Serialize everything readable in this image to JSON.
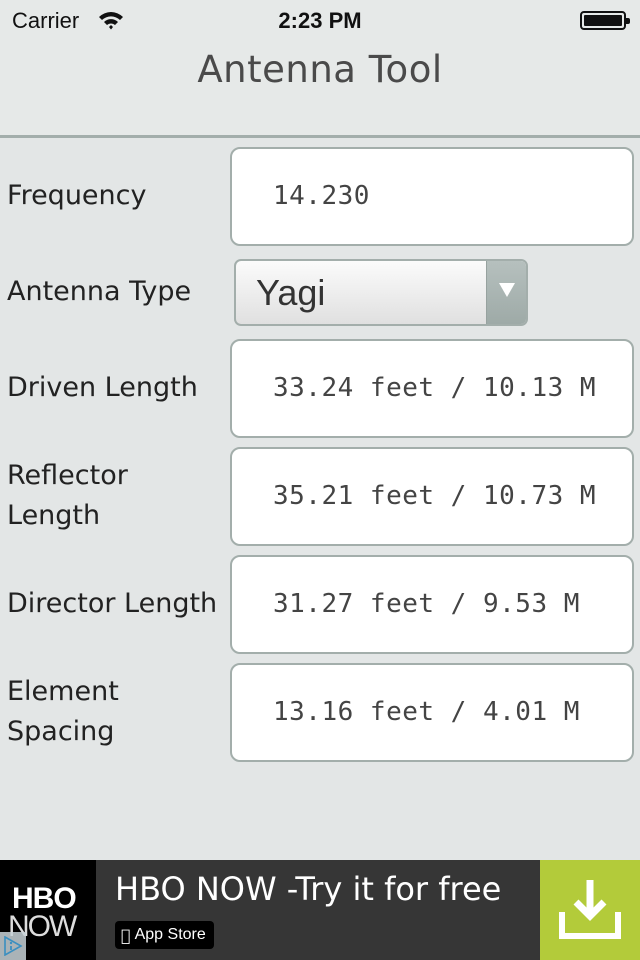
{
  "status_bar": {
    "carrier": "Carrier",
    "time": "2:23 PM",
    "wifi_icon": "wifi-icon",
    "battery_icon": "battery-full-icon"
  },
  "nav": {
    "title": "Antenna Tool"
  },
  "form": {
    "frequency": {
      "label": "Frequency",
      "value": "14.230"
    },
    "antenna_type": {
      "label": "Antenna Type",
      "selected": "Yagi",
      "dropdown_icon": "triangle-down-icon"
    },
    "driven_length": {
      "label": "Driven Length",
      "value": "33.24 feet / 10.13 M"
    },
    "reflector_length": {
      "label_line1": "Reflector",
      "label_line2": "Length",
      "value": "35.21 feet / 10.73 M"
    },
    "director_length": {
      "label": "Director Length",
      "value": "31.27 feet / 9.53 M"
    },
    "element_spacing": {
      "label_line1": "Element",
      "label_line2": "Spacing",
      "value": "13.16 feet / 4.01 M"
    }
  },
  "ad": {
    "logo_top": "HBO",
    "logo_bottom": "NOW",
    "headline": "HBO NOW -Try it for free",
    "store_badge": "App Store",
    "colors": {
      "background": "#363636",
      "download": "#b3cb3a"
    }
  }
}
